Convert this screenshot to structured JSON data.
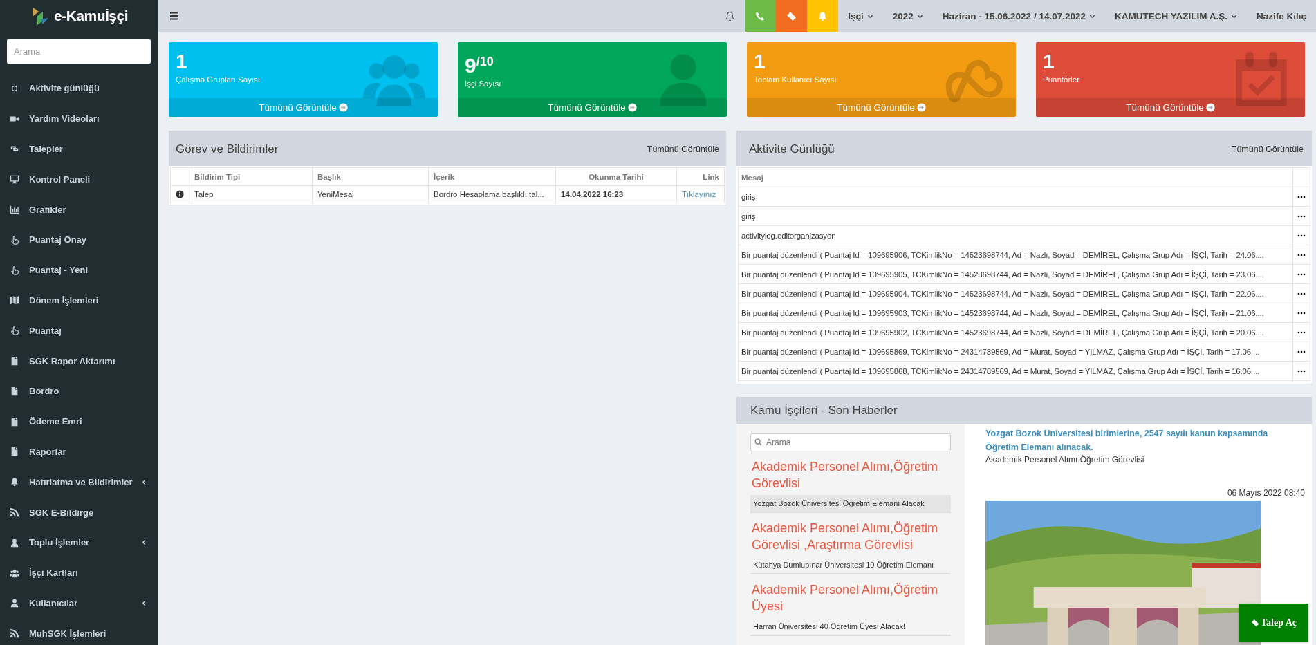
{
  "brand": {
    "name": "e-Kamuİşçi"
  },
  "sidebar": {
    "search_placeholder": "Arama",
    "items": [
      {
        "label": "Aktivite günlüğü",
        "kind": "circle",
        "submenu": false
      },
      {
        "label": "Yardım Videoları",
        "kind": "video",
        "submenu": false
      },
      {
        "label": "Talepler",
        "kind": "arrows",
        "submenu": false
      },
      {
        "label": "Kontrol Paneli",
        "kind": "monitor",
        "submenu": false
      },
      {
        "label": "Grafikler",
        "kind": "chart",
        "submenu": false
      },
      {
        "label": "Puantaj Onay",
        "kind": "hand",
        "submenu": false
      },
      {
        "label": "Puantaj - Yeni",
        "kind": "hand",
        "submenu": false
      },
      {
        "label": "Dönem İşlemleri",
        "kind": "map",
        "submenu": false
      },
      {
        "label": "Puantaj",
        "kind": "hand",
        "submenu": false
      },
      {
        "label": "SGK Rapor Aktarımı",
        "kind": "document",
        "submenu": false
      },
      {
        "label": "Bordro",
        "kind": "document",
        "submenu": false
      },
      {
        "label": "Ödeme Emri",
        "kind": "document",
        "submenu": false
      },
      {
        "label": "Raporlar",
        "kind": "document",
        "submenu": false
      },
      {
        "label": "Hatırlatma ve Bildirimler",
        "kind": "bell",
        "submenu": true
      },
      {
        "label": "SGK E-Bildirge",
        "kind": "rss",
        "submenu": false
      },
      {
        "label": "Toplu İşlemler",
        "kind": "user",
        "submenu": true
      },
      {
        "label": "İşçi Kartları",
        "kind": "users",
        "submenu": false
      },
      {
        "label": "Kullanıcılar",
        "kind": "user",
        "submenu": true
      },
      {
        "label": "MuhSGK İşlemleri",
        "kind": "rss",
        "submenu": false
      }
    ]
  },
  "topbar": {
    "quick_buttons": [
      {
        "kind": "phone",
        "color": "#6cbb46"
      },
      {
        "kind": "ticket",
        "color": "#f26d21"
      },
      {
        "kind": "bell",
        "color": "#ffc300"
      }
    ],
    "menus": [
      {
        "label": "İşçi",
        "dropdown": true
      },
      {
        "label": "2022",
        "dropdown": true
      },
      {
        "label": "Haziran - 15.06.2022 / 14.07.2022",
        "dropdown": true
      },
      {
        "label": "KAMUTECH YAZILIM A.Ş.",
        "dropdown": true
      },
      {
        "label": "Nazife Kılıç",
        "dropdown": false
      }
    ]
  },
  "stat_cards": [
    {
      "value": "1",
      "label": "Çalışma Grupları Sayısı",
      "link": "Tümünü Görüntüle",
      "color": "#00c0ef",
      "kind": "users"
    },
    {
      "value": "9$^{/10}$",
      "label": "İşçi Sayısı",
      "link": "Tümünü Görüntüle",
      "color": "#00a65a",
      "kind": "user"
    },
    {
      "value": "1",
      "label": "Toplam Kullanıcı Sayısı",
      "link": "Tümünü Görüntüle",
      "color": "#f39c12",
      "kind": "cloud"
    },
    {
      "value": "1",
      "label": "Puantörler",
      "link": "Tümünü Görüntüle",
      "color": "#dd4b39",
      "kind": "calendar"
    }
  ],
  "tasks": {
    "title": "Görev ve Bildirimler",
    "view_all": "Tümünü Görüntüle",
    "columns": [
      "Bildirim Tipi",
      "Başlık",
      "İçerik",
      "Okunma Tarihi",
      "Link"
    ],
    "rows": [
      {
        "kind": "info",
        "type": "Talep",
        "title": "YeniMesaj",
        "content": "Bordro Hesaplama başlıklı tal...",
        "read_at": "14.04.2022 16:23",
        "link": "Tıklayınız"
      }
    ]
  },
  "activity": {
    "title": "Aktivite Günlüğü",
    "view_all": "Tümünü Görüntüle",
    "column": "Mesaj",
    "rows": [
      "giriş",
      "giriş",
      "activitylog.editorganizasyon",
      "Bir puantaj düzenlendi ( Puantaj Id = 109695906, TCKimlikNo = 14523698744, Ad = Nazlı, Soyad = DEMİREL, Çalışma Grup Adı = İŞÇİ, Tarih = 24.06....",
      "Bir puantaj düzenlendi ( Puantaj Id = 109695905, TCKimlikNo = 14523698744, Ad = Nazlı, Soyad = DEMİREL, Çalışma Grup Adı = İŞÇİ, Tarih = 23.06....",
      "Bir puantaj düzenlendi ( Puantaj Id = 109695904, TCKimlikNo = 14523698744, Ad = Nazlı, Soyad = DEMİREL, Çalışma Grup Adı = İŞÇİ, Tarih = 22.06....",
      "Bir puantaj düzenlendi ( Puantaj Id = 109695903, TCKimlikNo = 14523698744, Ad = Nazlı, Soyad = DEMİREL, Çalışma Grup Adı = İŞÇİ, Tarih = 21.06....",
      "Bir puantaj düzenlendi ( Puantaj Id = 109695902, TCKimlikNo = 14523698744, Ad = Nazlı, Soyad = DEMİREL, Çalışma Grup Adı = İŞÇİ, Tarih = 20.06....",
      "Bir puantaj düzenlendi ( Puantaj Id = 109695869, TCKimlikNo = 24314789569, Ad = Murat, Soyad = YILMAZ, Çalışma Grup Adı = İŞÇİ, Tarih = 17.06....",
      "Bir puantaj düzenlendi ( Puantaj Id = 109695868, TCKimlikNo = 24314789569, Ad = Murat, Soyad = YILMAZ, Çalışma Grup Adı = İŞÇİ, Tarih = 16.06...."
    ]
  },
  "news": {
    "title": "Kamu İşçileri - Son Haberler",
    "search_placeholder": "Arama",
    "items": [
      {
        "category": "Akademik Personel Alımı,Öğretim Görevlisi",
        "title": "Yozgat Bozok Üniversitesi Öğretim Elemanı Alacak",
        "selected": true
      },
      {
        "category": "Akademik Personel Alımı,Öğretim Görevlisi ,Araştırma Görevlisi",
        "title": "Kütahya Dumlupınar Üniversitesi 10 Öğretim Elemanı",
        "selected": false
      },
      {
        "category": "Akademik Personel Alımı,Öğretim Üyesi",
        "title": "Harran Üniversitesi 40 Öğretim Üyesi Alacak!",
        "selected": false
      }
    ],
    "detail": {
      "headline": "Yozgat Bozok Üniversitesi birimlerine, 2547 sayılı kanun kapsamında Öğretim Elemanı alınacak.",
      "category": "Akademik Personel Alımı,Öğretim Görevlisi",
      "date": "06 Mayıs 2022 08:40"
    }
  },
  "float_button": {
    "label": "Talep Aç"
  }
}
